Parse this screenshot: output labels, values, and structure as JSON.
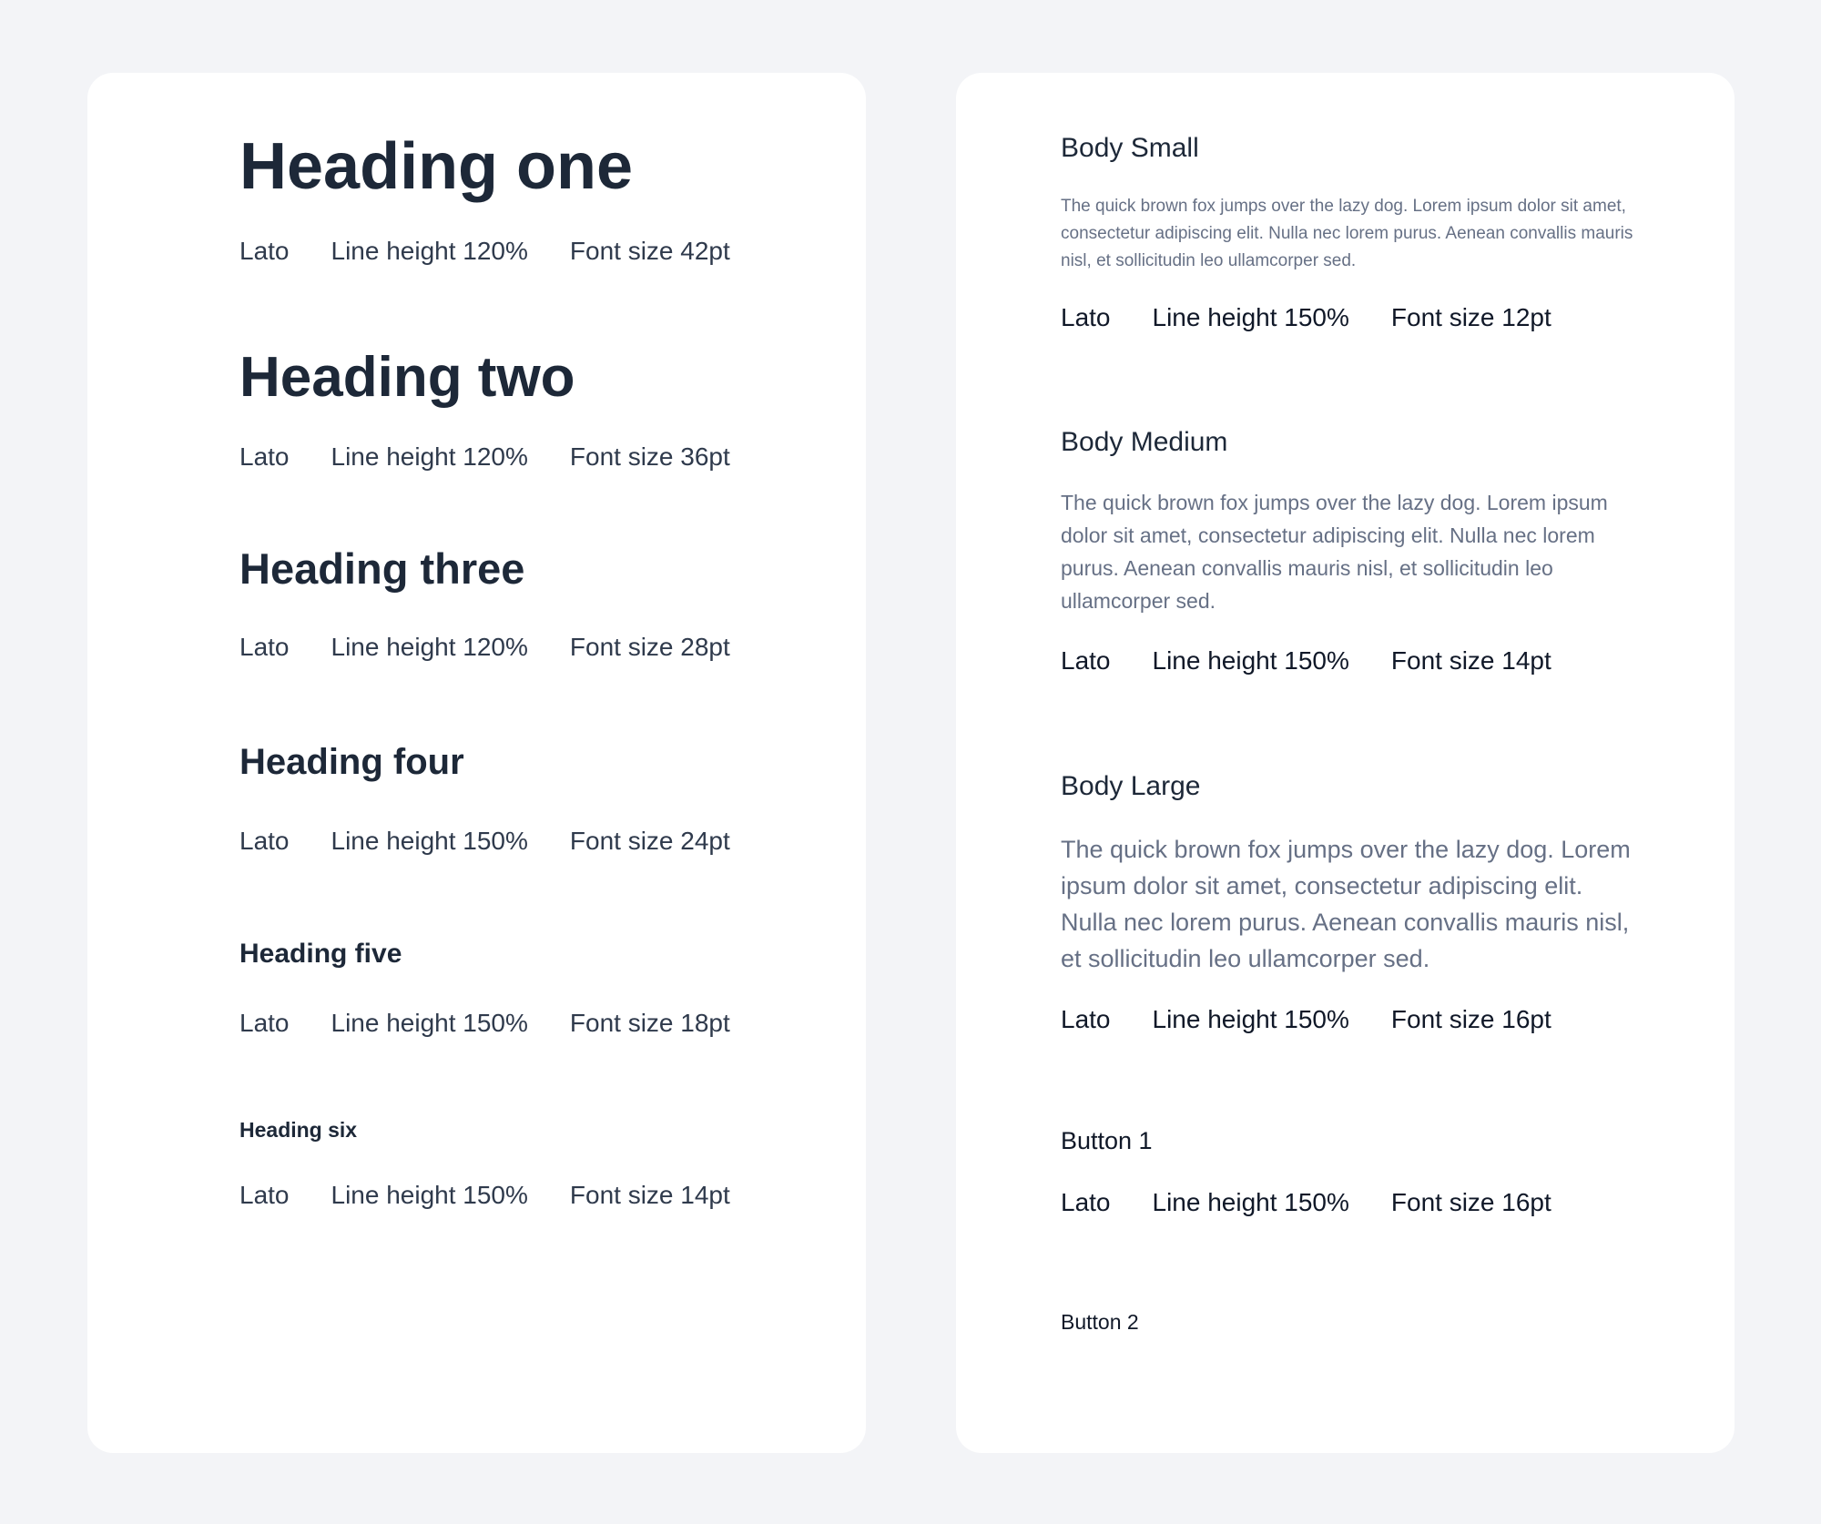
{
  "colors": {
    "page_background": "#f3f4f7",
    "card_background": "#ffffff",
    "heading": "#1d2838",
    "meta_left": "#2f3a4c",
    "meta_right": "#101828",
    "body_text": "#667085"
  },
  "headings": [
    {
      "title": "Heading one",
      "font": "Lato",
      "line_height": "Line height 120%",
      "font_size": "Font size 42pt"
    },
    {
      "title": "Heading two",
      "font": "Lato",
      "line_height": "Line height 120%",
      "font_size": "Font size 36pt"
    },
    {
      "title": "Heading three",
      "font": "Lato",
      "line_height": "Line height 120%",
      "font_size": "Font size 28pt"
    },
    {
      "title": "Heading four",
      "font": "Lato",
      "line_height": "Line height 150%",
      "font_size": "Font size 24pt"
    },
    {
      "title": "Heading five",
      "font": "Lato",
      "line_height": "Line height 150%",
      "font_size": "Font size 18pt"
    },
    {
      "title": "Heading six",
      "font": "Lato",
      "line_height": "Line height 150%",
      "font_size": "Font size 14pt"
    }
  ],
  "body_styles": [
    {
      "title": "Body Small",
      "sample": "The quick brown fox jumps over the lazy dog. Lorem ipsum dolor sit amet, consectetur adipiscing elit. Nulla nec lorem purus. Aenean convallis mauris nisl, et sollicitudin leo ullamcorper sed.",
      "font": "Lato",
      "line_height": "Line height 150%",
      "font_size": "Font size 12pt"
    },
    {
      "title": "Body Medium",
      "sample": "The quick brown fox jumps over the lazy dog. Lorem ipsum dolor sit amet, consectetur adipiscing elit. Nulla nec lorem purus. Aenean convallis mauris nisl, et sollicitudin leo ullamcorper sed.",
      "font": "Lato",
      "line_height": "Line height 150%",
      "font_size": "Font size 14pt"
    },
    {
      "title": "Body Large",
      "sample": "The quick brown fox jumps over the lazy dog. Lorem ipsum dolor sit amet, consectetur adipiscing elit. Nulla nec lorem purus. Aenean convallis mauris nisl, et sollicitudin leo ullamcorper sed.",
      "font": "Lato",
      "line_height": "Line height 150%",
      "font_size": "Font size 16pt"
    }
  ],
  "buttons": [
    {
      "title": "Button 1",
      "font": "Lato",
      "line_height": "Line height 150%",
      "font_size": "Font size 16pt"
    },
    {
      "title": "Button 2"
    }
  ]
}
